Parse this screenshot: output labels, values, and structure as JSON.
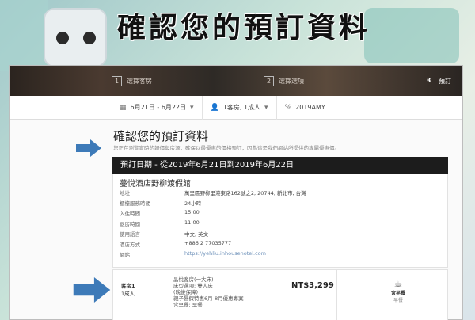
{
  "headline": "確認您的預訂資料",
  "steps": [
    {
      "num": "1",
      "label": "選擇客房"
    },
    {
      "num": "2",
      "label": "選擇選項"
    },
    {
      "num": "3",
      "label": "預訂"
    }
  ],
  "filters": {
    "dates": "6月21日 - 6月22日",
    "guests": "1客房, 1成人",
    "promo": "2019AMY"
  },
  "page": {
    "title": "確認您的預訂資料",
    "subtitle": "您正在瀏覽實時的報價與房源，確保以最優惠的價格預訂，因為這是我們網站所提供的專屬優惠價。"
  },
  "booking": {
    "date_bar": "預訂日期 - 從2019年6月21日到2019年6月22日",
    "hotel_name": "蔓悅酒店野柳渡假館",
    "rows": [
      {
        "label": "地址",
        "value": "萬里區野柳里港東路162號之2, 20744, 新北市, 台灣"
      },
      {
        "label": "櫃檯服務時間",
        "value": "24小時"
      },
      {
        "label": "入住時間",
        "value": "15:00"
      },
      {
        "label": "退房時間",
        "value": "11:00"
      },
      {
        "label": "使用語言",
        "value": "中文, 英文"
      },
      {
        "label": "酒店方式",
        "value": "+886 2 77035777"
      },
      {
        "label": "網站",
        "value": "https://yehliu.inhousehotel.com"
      }
    ]
  },
  "room": {
    "title": "客房1",
    "guests": "1成人",
    "lines": [
      "晶悅客房(一大床)",
      "床型選項: 雙人床",
      "(晚後保障)",
      "親子暑假特惠6月-8月優惠專案",
      "含早餐: 早餐"
    ],
    "price": "NT$3,299",
    "meal_label": "含早餐",
    "meal_sub": "早餐"
  },
  "colors": {
    "arrow": "#3d7ab8",
    "date_bar": "#1c1c1c"
  }
}
